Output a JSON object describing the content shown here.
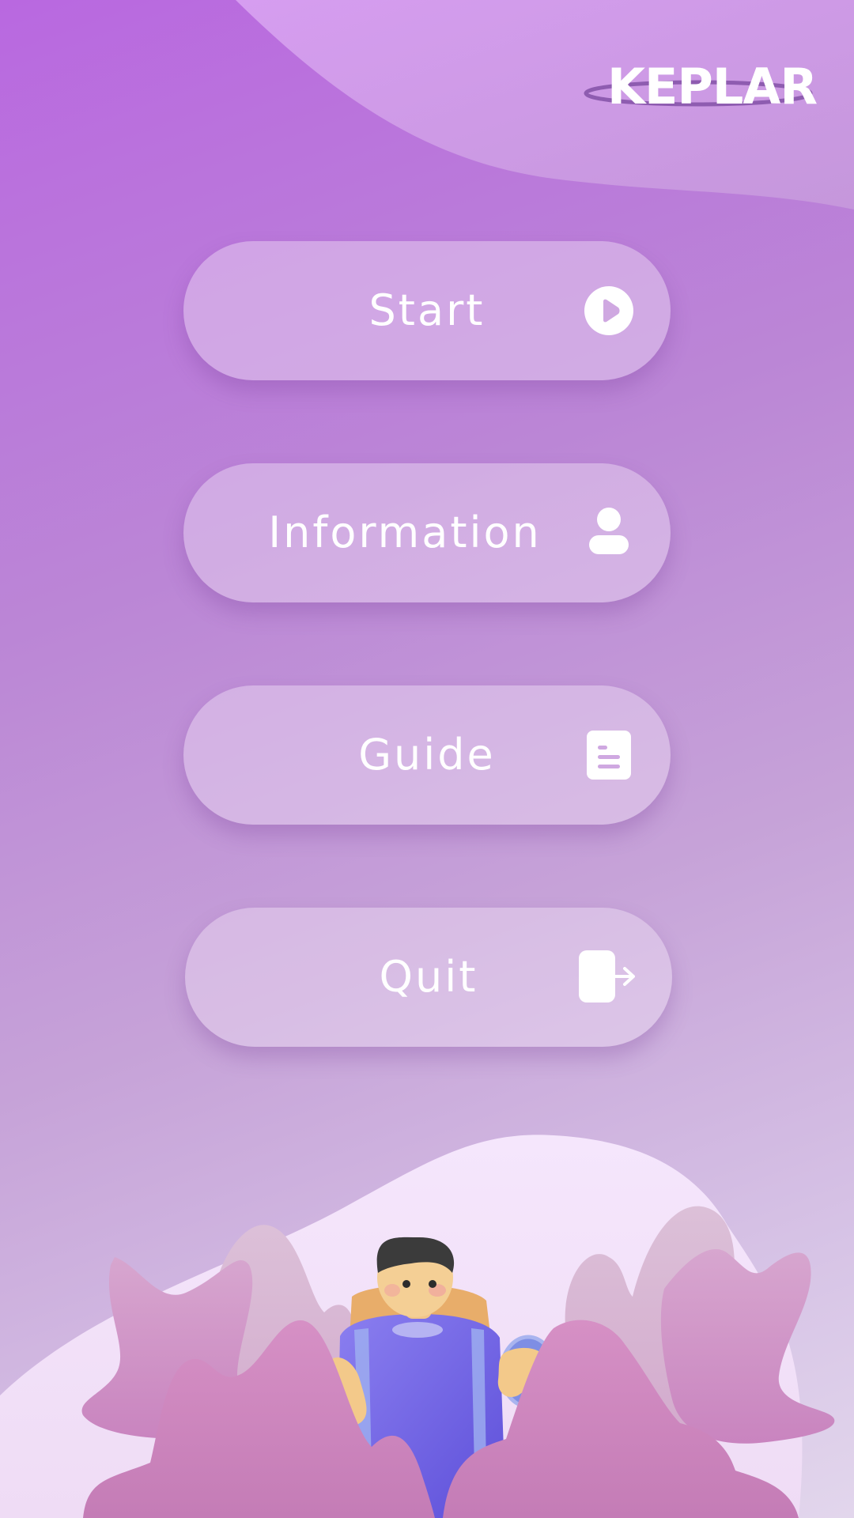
{
  "app": {
    "logo_text": "KEPLAR"
  },
  "menu": {
    "items": [
      {
        "label": "Start",
        "icon": "play-circle-icon"
      },
      {
        "label": "Information",
        "icon": "user-icon"
      },
      {
        "label": "Guide",
        "icon": "document-icon"
      },
      {
        "label": "Quit",
        "icon": "exit-door-icon"
      }
    ]
  },
  "colors": {
    "background_top": "#b968e0",
    "background_bottom": "#e2d6ec",
    "button_fill": "#e9d8f2",
    "button_text": "#ffffff",
    "accent_dark": "#8e5cb0"
  }
}
